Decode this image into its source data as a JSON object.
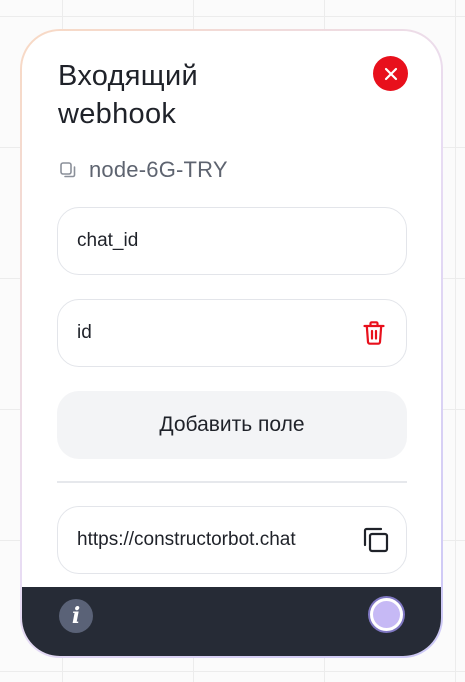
{
  "node": {
    "title": "Входящий webhook",
    "node_id": "node-6G-TRY",
    "fields": [
      {
        "value": "chat_id"
      },
      {
        "value": "id"
      }
    ],
    "add_field_label": "Добавить поле",
    "webhook_url": "https://constructorbot.chat"
  },
  "footer": {
    "info_label": "i"
  },
  "icons": {
    "close": "close-icon",
    "copy_small": "copy-icon",
    "trash": "trash-icon",
    "copy_url": "copy-icon",
    "info": "info-icon",
    "handle": "connector-handle"
  },
  "colors": {
    "close_red": "#e8101c",
    "trash_red": "#e8101c",
    "footer_bg": "#262b36",
    "handle_fill": "#c6b9f5",
    "text_dark": "#1f2229",
    "text_muted": "#5e6470"
  }
}
